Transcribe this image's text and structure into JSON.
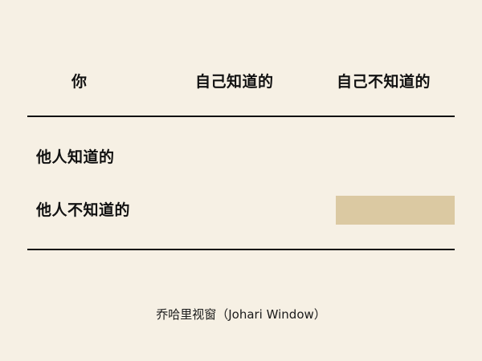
{
  "johari_table": {
    "corner_label": "你",
    "columns": [
      "自己知道的",
      "自己不知道的"
    ],
    "rows": [
      "他人知道的",
      "他人不知道的"
    ],
    "highlighted_quadrant": {
      "row": "他人不知道的",
      "column": "自己不知道的",
      "color": "#dbc9a2"
    }
  },
  "caption": "乔哈里视窗（Johari Window）",
  "colors": {
    "background": "#f6f0e4",
    "text": "#111111",
    "rule": "#111111"
  }
}
